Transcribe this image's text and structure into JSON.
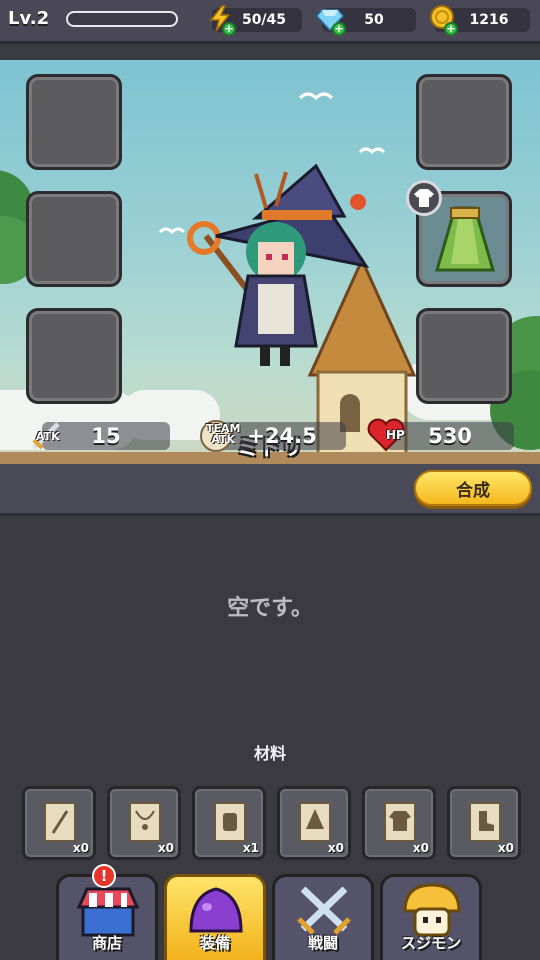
{
  "header": {
    "level": "Lv.2",
    "xp_progress": 0,
    "energy": "50/45",
    "gems": "50",
    "coins": "1216"
  },
  "character": {
    "name": "ミドリ",
    "outfit_slot_icon": "shirt-icon"
  },
  "stats": {
    "atk_label": "ATK",
    "atk_value": "15",
    "team_label_1": "TEAM",
    "team_label_2": "ATK",
    "team_atk_value": "+24.5",
    "hp_label": "HP",
    "hp_value": "530"
  },
  "synthesize_label": "合成",
  "empty_message": "空です。",
  "materials_title": "材料",
  "materials": [
    {
      "icon": "staff-scroll-icon",
      "count": "x0"
    },
    {
      "icon": "necklace-scroll-icon",
      "count": "x0"
    },
    {
      "icon": "glove-scroll-icon",
      "count": "x1"
    },
    {
      "icon": "hat-scroll-icon",
      "count": "x0"
    },
    {
      "icon": "shirt-scroll-icon",
      "count": "x0"
    },
    {
      "icon": "boot-scroll-icon",
      "count": "x0"
    }
  ],
  "nav": {
    "shop": "商店",
    "equipment": "装備",
    "battle": "戦闘",
    "slimes": "スジモン",
    "shop_badge": "!"
  },
  "colors": {
    "accent_gold": "#f5b81d",
    "panel_dark": "#3b3a41",
    "hp_red": "#d9262a"
  }
}
